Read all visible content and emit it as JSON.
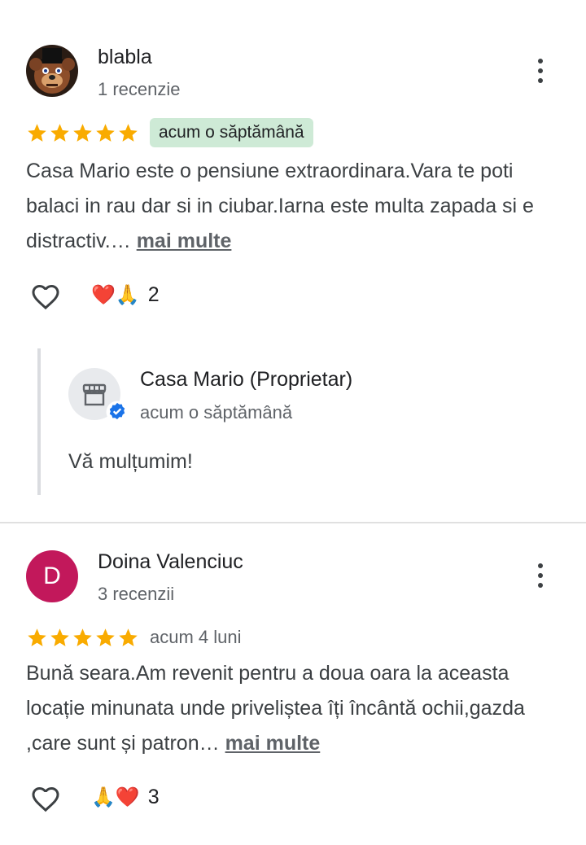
{
  "reviews": [
    {
      "author": "blabla",
      "review_count": "1 recenzie",
      "rating": 5,
      "date": "acum o săptămână",
      "text": "Casa Mario este o pensiune extraordinara.Vara te poti balaci in rau dar si in ciubar.Iarna este multa zapada si e distractiv.…",
      "more_label": "mai multe",
      "reactions_emoji": "❤️🙏",
      "reactions_count": "2",
      "owner_reply": {
        "name": "Casa Mario (Proprietar)",
        "date": "acum o săptămână",
        "text": "Vă mulțumim!"
      }
    },
    {
      "author": "Doina Valenciuc",
      "avatar_letter": "D",
      "avatar_color": "#c2185b",
      "review_count": "3 recenzii",
      "rating": 5,
      "date": "acum 4 luni",
      "text": "Bună seara.Am revenit pentru a doua oara la aceasta locație minunata unde priveliștea îți încântă ochii,gazda ,care sunt și patron…",
      "more_label": "mai multe",
      "reactions_emoji": "🙏❤️",
      "reactions_count": "3"
    }
  ],
  "colors": {
    "star": "#f9ab00",
    "date_highlight": "#ceead6",
    "verified": "#1a73e8"
  }
}
